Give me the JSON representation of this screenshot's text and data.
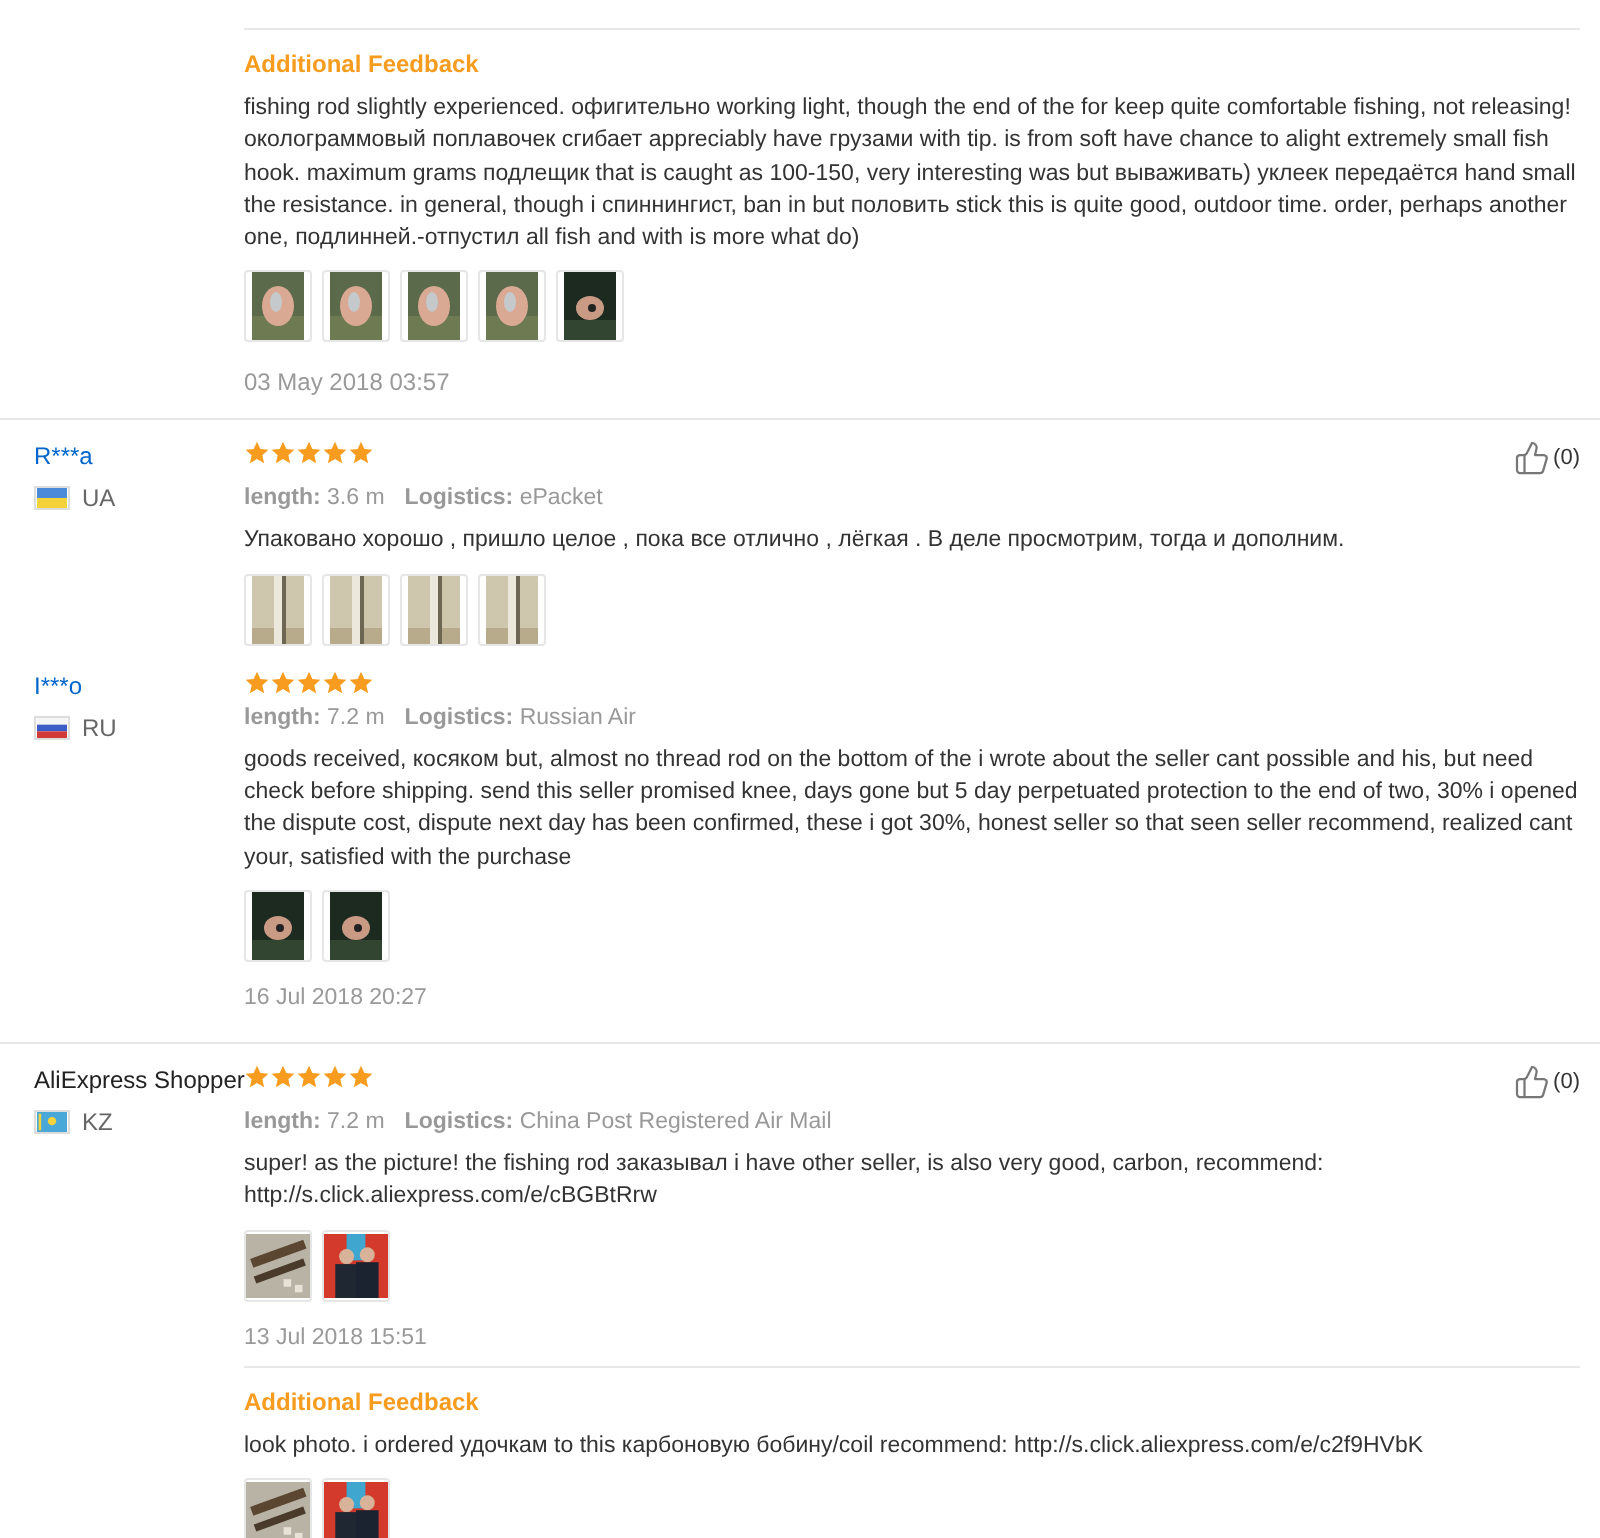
{
  "reviews": [
    {
      "kind": "continuation",
      "additional": {
        "title": "Additional Feedback",
        "text": "fishing rod slightly experienced. офигительно working light, though the end of the for keep quite comfortable fishing, not releasing! околограммовый поплавочек сгибает appreciably have грузами with tip. is from soft have chance to alight extremely small fish hook. maximum grams подлещик that is caught as 100-150, very interesting was but вываживать) уклеек передаётся hand small the resistance. in general, though i спиннингист, ban in but половить stick this is quite good, outdoor time. order, perhaps another one, подлинней.-отпустил all fish and with is more what do)",
        "photos": [
          {
            "kind": "hand"
          },
          {
            "kind": "hand"
          },
          {
            "kind": "hand"
          },
          {
            "kind": "hand"
          },
          {
            "kind": "dark"
          }
        ],
        "date": "03 May 2018 03:57"
      }
    },
    {
      "kind": "review",
      "divider_above": true,
      "user": "R***a",
      "linked": true,
      "country": "UA",
      "flag": {
        "kind": "ua"
      },
      "stars": 5,
      "length_label": "length:",
      "length": "3.6 m",
      "logistics_label": "Logistics:",
      "logistics": "ePacket",
      "likes": "(0)",
      "text": "Упаковано хорошо , пришло целое , пока все отлично , лёгкая . В деле просмотрим, тогда и дополним.",
      "photos": [
        {
          "kind": "rod"
        },
        {
          "kind": "rod"
        },
        {
          "kind": "rod"
        },
        {
          "kind": "rod"
        }
      ]
    },
    {
      "kind": "review",
      "divider_above": false,
      "user": "I***o",
      "linked": true,
      "country": "RU",
      "flag": {
        "kind": "ru"
      },
      "stars": 5,
      "length_label": "length:",
      "length": "7.2 m",
      "logistics_label": "Logistics:",
      "logistics": "Russian Air",
      "text": "goods received, косяком but, almost no thread rod on the bottom of the i wrote about the seller cant possible and his, but need check before shipping. send this seller promised knee, days gone but 5 day perpetuated protection to the end of two, 30% i opened the dispute cost, dispute next day has been confirmed, these i got 30%, honest seller so that seen seller recommend, realized cant your, satisfied with the purchase",
      "photos": [
        {
          "kind": "dark"
        },
        {
          "kind": "dark"
        }
      ],
      "date": "16 Jul 2018 20:27"
    },
    {
      "kind": "review",
      "divider_above": true,
      "user": "AliExpress Shopper",
      "linked": false,
      "country": "KZ",
      "flag": {
        "kind": "kz"
      },
      "stars": 5,
      "length_label": "length:",
      "length": "7.2 m",
      "logistics_label": "Logistics:",
      "logistics": "China Post Registered Air Mail",
      "likes": "(0)",
      "text": "super! as the picture! the fishing rod заказывал i have other seller, is also very good, carbon, recommend: http://s.click.aliexpress.com/e/cBGBtRrw",
      "photos": [
        {
          "kind": "tools"
        },
        {
          "kind": "people"
        }
      ],
      "date": "13 Jul 2018 15:51",
      "additional": {
        "title": "Additional Feedback",
        "text": "look photo. i ordered удочкам to this карбоновую бобину/coil recommend: http://s.click.aliexpress.com/e/c2f9HVbK",
        "photos": [
          {
            "kind": "tools"
          },
          {
            "kind": "people"
          }
        ]
      }
    }
  ]
}
